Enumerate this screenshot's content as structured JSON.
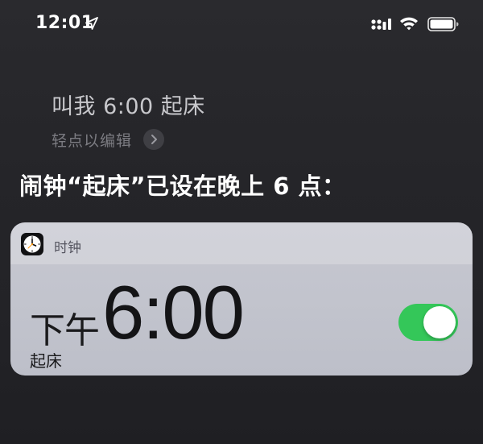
{
  "status_bar": {
    "time": "12:01",
    "icons": [
      "location-arrow-icon",
      "cellular-signal-icon",
      "wifi-icon",
      "battery-icon"
    ]
  },
  "siri": {
    "query": "叫我 6:00 起床",
    "edit_hint": "轻点以编辑",
    "response": "闹钟“起床”已设在晚上 6 点："
  },
  "alarm_card": {
    "app_name": "时钟",
    "app_icon": "clock-app-icon",
    "meridiem": "下午",
    "time": "6:00",
    "label": "起床",
    "enabled": true
  },
  "colors": {
    "toggle_on": "#34c759",
    "background": "#252529",
    "card": "#c4c6cf"
  }
}
